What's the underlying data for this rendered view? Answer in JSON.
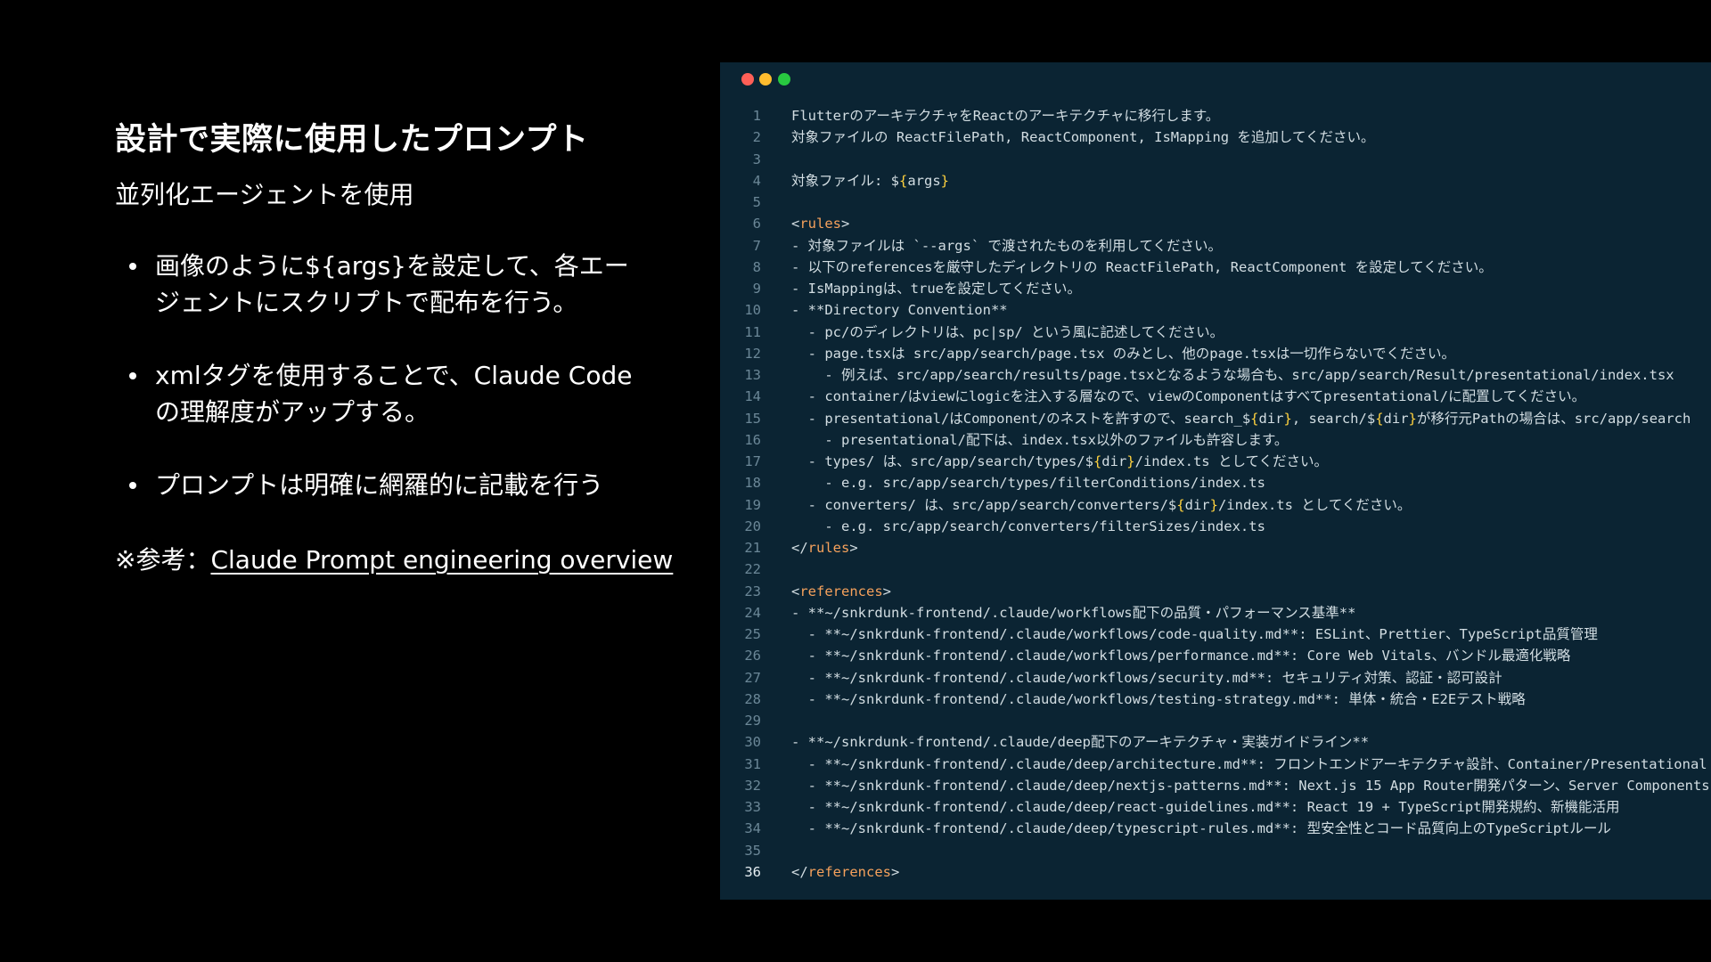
{
  "slide": {
    "title": "設計で実際に使用したプロンプト",
    "subtitle": "並列化エージェントを使用",
    "bullets": [
      {
        "line1": "画像のように${args}を設定して、各エー",
        "line2": "ジェントにスクリプトで配布を行う。"
      },
      {
        "line1": "xmlタグを使用することで、Claude Code",
        "line2": "の理解度がアップする。"
      },
      {
        "line1": "プロンプトは明確に網羅的に記載を行う",
        "line2": ""
      }
    ],
    "reference_prefix": "※参考：",
    "reference_link": "Claude Prompt engineering overview"
  },
  "editor": {
    "active_line": 36,
    "lines": [
      "FlutterのアーキテクチャをReactのアーキテクチャに移行します。",
      "対象ファイルの ReactFilePath, ReactComponent, IsMapping を追加してください。",
      "",
      "対象ファイル: ${args}",
      "",
      "<rules>",
      "- 対象ファイルは `--args` で渡されたものを利用してください。",
      "- 以下のreferencesを厳守したディレクトリの ReactFilePath, ReactComponent を設定してください。",
      "- IsMappingは、trueを設定してください。",
      "- **Directory Convention**",
      "  - pc/のディレクトリは、pc|sp/ という風に記述してください。",
      "  - page.tsxは src/app/search/page.tsx のみとし、他のpage.tsxは一切作らないでください。",
      "    - 例えば、src/app/search/results/page.tsxとなるような場合も、src/app/search/Result/presentational/index.tsx",
      "  - container/はviewにlogicを注入する層なので、viewのComponentはすべてpresentational/に配置してください。",
      "  - presentational/はComponent/のネストを許すので、search_${dir}, search/${dir}が移行元Pathの場合は、src/app/search",
      "    - presentational/配下は、index.tsx以外のファイルも許容します。",
      "  - types/ は、src/app/search/types/${dir}/index.ts としてください。",
      "    - e.g. src/app/search/types/filterConditions/index.ts",
      "  - converters/ は、src/app/search/converters/${dir}/index.ts としてください。",
      "    - e.g. src/app/search/converters/filterSizes/index.ts",
      "</rules>",
      "",
      "<references>",
      "- **~/snkrdunk-frontend/.claude/workflows配下の品質・パフォーマンス基準**",
      "  - **~/snkrdunk-frontend/.claude/workflows/code-quality.md**: ESLint、Prettier、TypeScript品質管理",
      "  - **~/snkrdunk-frontend/.claude/workflows/performance.md**: Core Web Vitals、バンドル最適化戦略",
      "  - **~/snkrdunk-frontend/.claude/workflows/security.md**: セキュリティ対策、認証・認可設計",
      "  - **~/snkrdunk-frontend/.claude/workflows/testing-strategy.md**: 単体・統合・E2Eテスト戦略",
      "",
      "- **~/snkrdunk-frontend/.claude/deep配下のアーキテクチャ・実装ガイドライン**",
      "  - **~/snkrdunk-frontend/.claude/deep/architecture.md**: フロントエンドアーキテクチャ設計、Container/Presentational",
      "  - **~/snkrdunk-frontend/.claude/deep/nextjs-patterns.md**: Next.js 15 App Router開発パターン、Server Components",
      "  - **~/snkrdunk-frontend/.claude/deep/react-guidelines.md**: React 19 + TypeScript開発規約、新機能活用",
      "  - **~/snkrdunk-frontend/.claude/deep/typescript-rules.md**: 型安全性とコード品質向上のTypeScriptルール",
      "",
      "</references>"
    ]
  }
}
